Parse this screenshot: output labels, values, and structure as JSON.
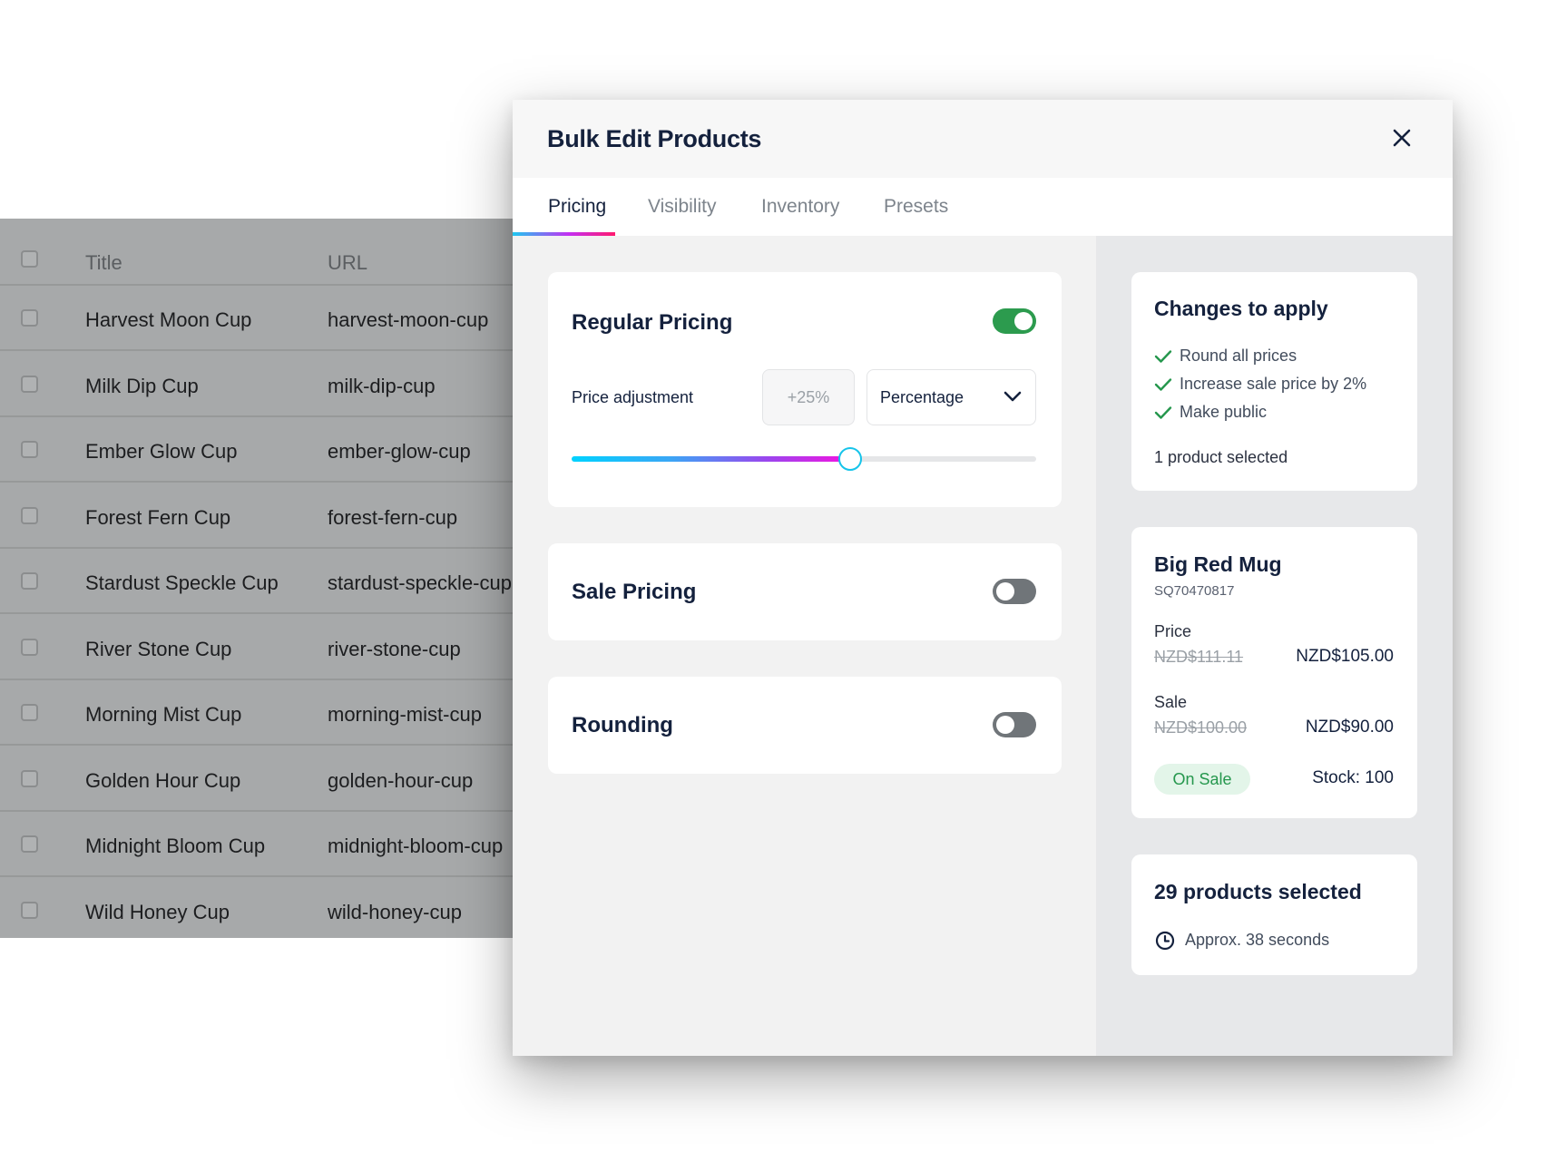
{
  "table": {
    "header": {
      "title": "Title",
      "url": "URL"
    },
    "rows": [
      {
        "title": "Harvest Moon Cup",
        "url": "harvest-moon-cup"
      },
      {
        "title": "Milk Dip Cup",
        "url": "milk-dip-cup"
      },
      {
        "title": "Ember Glow Cup",
        "url": "ember-glow-cup"
      },
      {
        "title": "Forest Fern Cup",
        "url": "forest-fern-cup"
      },
      {
        "title": "Stardust Speckle Cup",
        "url": "stardust-speckle-cup"
      },
      {
        "title": "River Stone Cup",
        "url": "river-stone-cup"
      },
      {
        "title": "Morning Mist Cup",
        "url": "morning-mist-cup"
      },
      {
        "title": "Golden Hour Cup",
        "url": "golden-hour-cup"
      },
      {
        "title": "Midnight Bloom Cup",
        "url": "midnight-bloom-cup"
      },
      {
        "title": "Wild Honey Cup",
        "url": "wild-honey-cup"
      }
    ]
  },
  "modal": {
    "title": "Bulk Edit Products",
    "close_icon": "close-icon",
    "tabs": [
      {
        "label": "Pricing",
        "active": true
      },
      {
        "label": "Visibility",
        "active": false
      },
      {
        "label": "Inventory",
        "active": false
      },
      {
        "label": "Presets",
        "active": false
      }
    ]
  },
  "regular_pricing": {
    "title": "Regular Pricing",
    "enabled": true,
    "adjustment_label": "Price adjustment",
    "adjustment_placeholder": "+25%",
    "adjustment_value": "",
    "type_selected": "Percentage",
    "slider_fraction": 0.6
  },
  "sale_pricing": {
    "title": "Sale Pricing",
    "enabled": false
  },
  "rounding": {
    "title": "Rounding",
    "enabled": false
  },
  "changes": {
    "title": "Changes to apply",
    "items": [
      "Round all prices",
      "Increase sale price by 2%",
      "Make public"
    ],
    "summary": "1 product selected"
  },
  "product": {
    "name": "Big Red Mug",
    "sku": "SQ70470817",
    "price_label": "Price",
    "price_old": "NZD$111.11",
    "price_new": "NZD$105.00",
    "sale_label": "Sale",
    "sale_old": "NZD$100.00",
    "sale_new": "NZD$90.00",
    "badge": "On Sale",
    "stock": "Stock: 100"
  },
  "selection": {
    "title": "29 products selected",
    "eta": "Approx. 38 seconds",
    "eta_icon": "clock-icon"
  },
  "colors": {
    "navy": "#14213d",
    "toggle_on": "#2c9b4e",
    "toggle_off": "#707579",
    "check_green": "#25974d",
    "slider_thumb": "#16c4ea"
  }
}
